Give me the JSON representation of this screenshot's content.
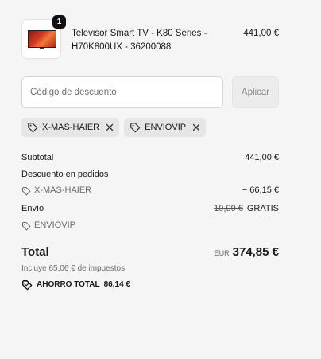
{
  "product": {
    "quantity": "1",
    "name_line1": "Televisor Smart TV - K80 Series -",
    "name_line2": "H70K800UX - 36200088",
    "price": "441,00 €"
  },
  "discount": {
    "placeholder": "Código de descuento",
    "value": "",
    "apply_label": "Aplicar"
  },
  "applied_codes": [
    {
      "code": "X-MAS-HAIER"
    },
    {
      "code": "ENVIOVIP"
    }
  ],
  "summary": {
    "subtotal_label": "Subtotal",
    "subtotal_value": "441,00 €",
    "order_discount_label": "Descuento en pedidos",
    "order_discount_code": "X-MAS-HAIER",
    "order_discount_value": "− 66,15 €",
    "shipping_label": "Envío",
    "shipping_original": "19,99 €",
    "shipping_value": "GRATIS",
    "shipping_code": "ENVIOVIP"
  },
  "total": {
    "label": "Total",
    "currency": "EUR",
    "value": "374,85 €",
    "taxes_text": "Incluye 65,06 € de impuestos",
    "savings_label": "AHORRO TOTAL",
    "savings_value": "86,14 €"
  },
  "icons": {
    "tag": "tag-icon",
    "close": "close-icon",
    "savings": "savings-tag-icon"
  },
  "colors": {
    "background": "#f5f5f5",
    "tag_background": "#e6e6e6",
    "muted_text": "#6b6b6b"
  }
}
